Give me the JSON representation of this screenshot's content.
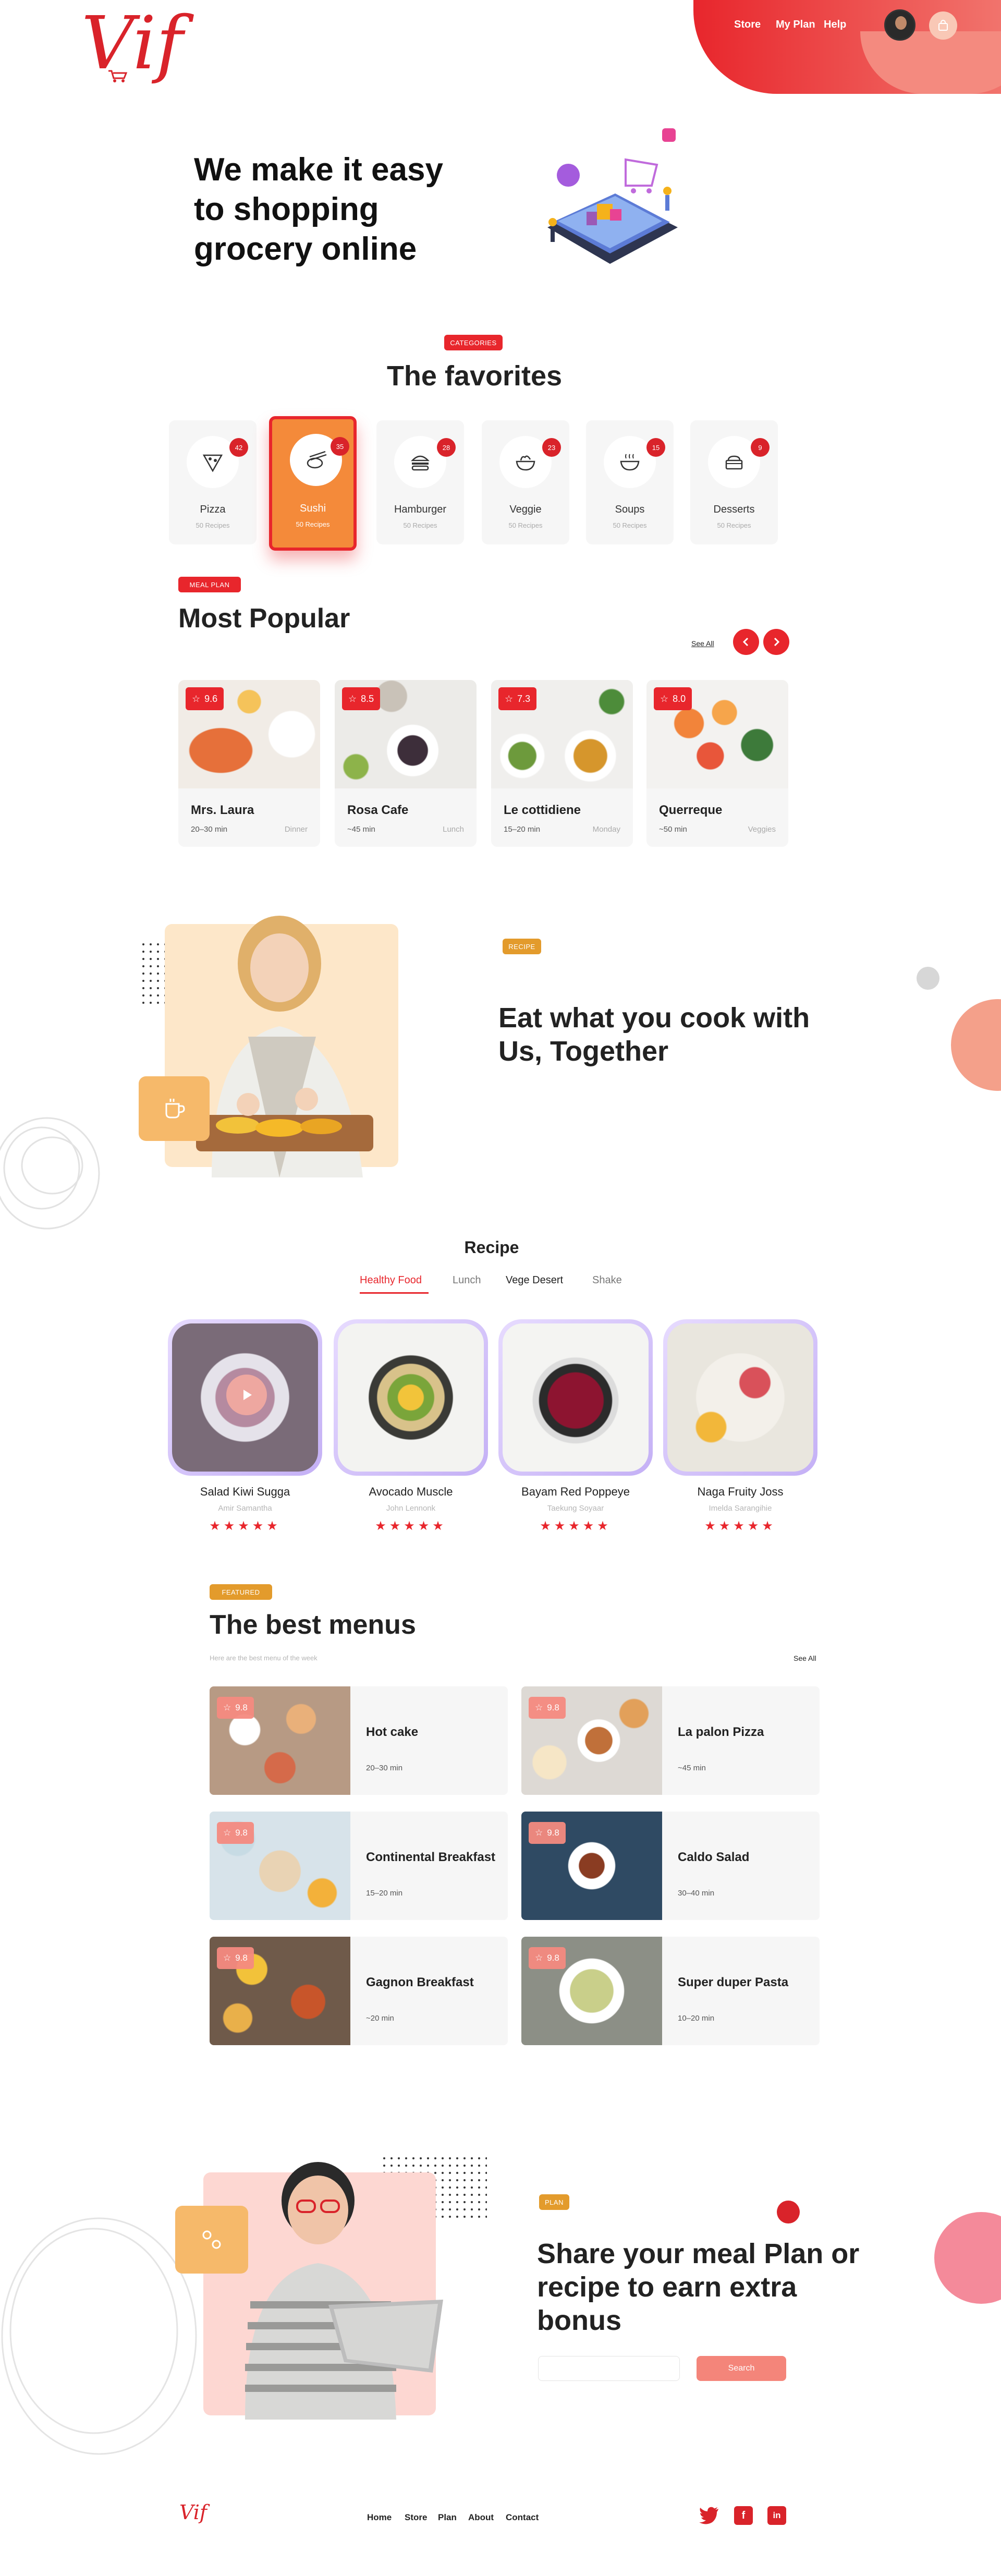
{
  "header": {
    "logo": "Vif",
    "nav": [
      "Store",
      "My Plan",
      "Help"
    ]
  },
  "hero": {
    "title": "We make it easy to shopping grocery online"
  },
  "categories": {
    "tag": "CATEGORIES",
    "title": "The favorites",
    "items": [
      {
        "name": "Pizza",
        "sub": "50 Recipes",
        "count": "42",
        "icon": "pizza-icon"
      },
      {
        "name": "Sushi",
        "sub": "50 Recipes",
        "count": "35",
        "icon": "sushi-icon",
        "active": true
      },
      {
        "name": "Hamburger",
        "sub": "50 Recipes",
        "count": "28",
        "icon": "hamburger-icon"
      },
      {
        "name": "Veggie",
        "sub": "50 Recipes",
        "count": "23",
        "icon": "veggie-icon"
      },
      {
        "name": "Soups",
        "sub": "50 Recipes",
        "count": "15",
        "icon": "soup-icon"
      },
      {
        "name": "Desserts",
        "sub": "50 Recipes",
        "count": "9",
        "icon": "dessert-icon"
      }
    ]
  },
  "popular": {
    "tag": "MEAL PLAN",
    "title": "Most Popular",
    "see_all": "See All",
    "items": [
      {
        "name": "Mrs. Laura",
        "time": "20–30 min",
        "meal": "Dinner",
        "rating": "9.6"
      },
      {
        "name": "Rosa Cafe",
        "time": "~45 min",
        "meal": "Lunch",
        "rating": "8.5"
      },
      {
        "name": "Le cottidiene",
        "time": "15–20 min",
        "meal": "Monday",
        "rating": "7.3"
      },
      {
        "name": "Querreque",
        "time": "~50 min",
        "meal": "Veggies",
        "rating": "8.0"
      }
    ]
  },
  "feature": {
    "tag": "RECIPE",
    "title": "Eat what you cook with Us, Together"
  },
  "recipe": {
    "title": "Recipe",
    "tabs": [
      "Healthy Food",
      "Lunch",
      "Vege Desert",
      "Shake"
    ],
    "items": [
      {
        "name": "Salad Kiwi Sugga",
        "author": "Amir Samantha"
      },
      {
        "name": "Avocado Muscle",
        "author": "John Lennonk"
      },
      {
        "name": "Bayam Red Poppeye",
        "author": "Taekung Soyaar"
      },
      {
        "name": "Naga Fruity Joss",
        "author": "Imelda Sarangihie"
      }
    ],
    "stars": "★★★★★"
  },
  "menus": {
    "tag": "FEATURED",
    "title": "The best menus",
    "subtitle": "Here are the best menu of the week",
    "see_all": "See All",
    "items": [
      {
        "name": "Hot cake",
        "time": "20–30 min",
        "rating": "9.8"
      },
      {
        "name": "La palon Pizza",
        "time": "~45 min",
        "rating": "9.8"
      },
      {
        "name": "Continental Breakfast",
        "time": "15–20 min",
        "rating": "9.8"
      },
      {
        "name": "Caldo Salad",
        "time": "30–40 min",
        "rating": "9.8"
      },
      {
        "name": "Gagnon Breakfast",
        "time": "~20 min",
        "rating": "9.8"
      },
      {
        "name": "Super duper Pasta",
        "time": "10–20 min",
        "rating": "9.8"
      }
    ]
  },
  "share": {
    "tag": "PLAN",
    "title": "Share your meal Plan or recipe to earn extra bonus",
    "input_placeholder": "",
    "button": "Search"
  },
  "footer": {
    "logo": "Vif",
    "nav": [
      "Home",
      "Store",
      "Plan",
      "About",
      "Contact"
    ],
    "social": [
      "twitter-icon",
      "facebook-icon",
      "linkedin-icon"
    ]
  },
  "colors": {
    "primary": "#e8262c",
    "accent_orange": "#f48a3a",
    "salmon": "#f48a7f",
    "tag_orange": "#e39b2c"
  }
}
